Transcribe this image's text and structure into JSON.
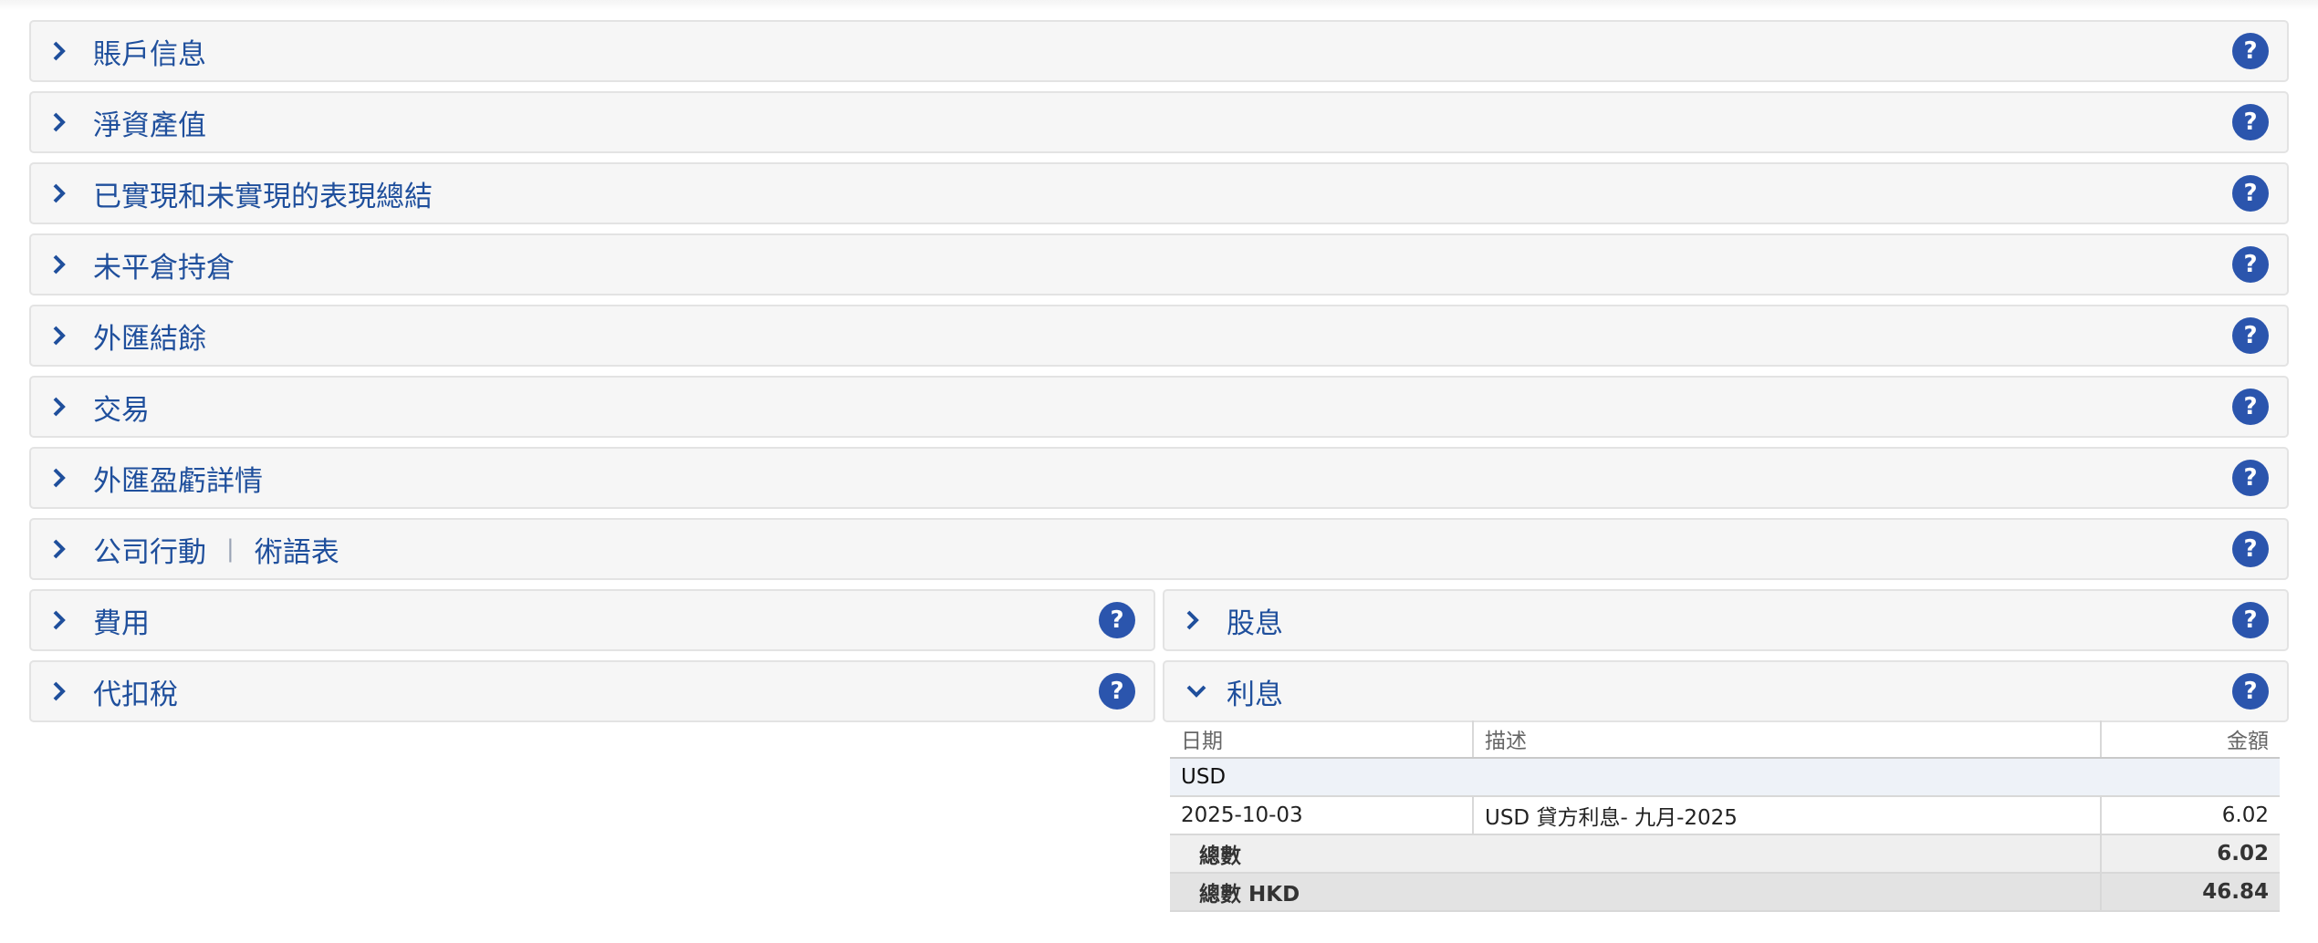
{
  "sections": {
    "account_info": "賬戶信息",
    "nav": "淨資產值",
    "realized_unrealized": "已實現和未實現的表現總結",
    "open_positions": "未平倉持倉",
    "forex_balances": "外匯結餘",
    "trades": "交易",
    "forex_pnl": "外匯盈虧詳情",
    "corporate_actions": "公司行動",
    "glossary": "術語表",
    "fees": "費用",
    "dividends": "股息",
    "withholding_tax": "代扣稅",
    "interest": "利息"
  },
  "help_label": "?",
  "separator": "|",
  "interest_table": {
    "headers": {
      "date": "日期",
      "description": "描述",
      "amount": "金額"
    },
    "currency": "USD",
    "row": {
      "date": "2025-10-03",
      "description": "USD 貸方利息- 九月-2025",
      "amount": "6.02"
    },
    "total": {
      "label": "總數",
      "amount": "6.02"
    },
    "total_hkd": {
      "label": "總數 HKD",
      "amount": "46.84"
    }
  }
}
